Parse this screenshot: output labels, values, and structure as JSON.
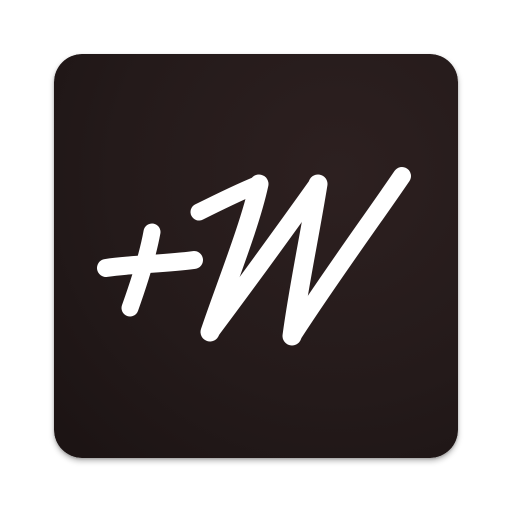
{
  "icon": {
    "name": "plus-w-app-icon",
    "logo_text": "+W",
    "background_color": "#241a1a",
    "background_gradient_from": "#2d2020",
    "background_gradient_to": "#1b1313",
    "glyph_color": "#ffffff"
  }
}
